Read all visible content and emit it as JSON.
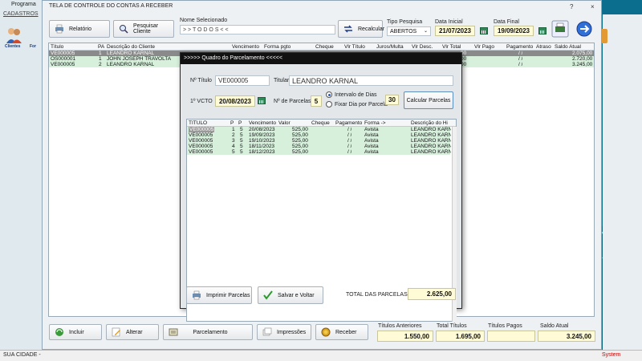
{
  "app": {
    "bg_title": "Programa",
    "bg_menu": "CADASTROS",
    "bg_icons": [
      "Clientes",
      "For"
    ],
    "status_left": "SUA CIDADE -",
    "status_right": "System"
  },
  "window": {
    "title": "TELA DE CONTROLE DO CONTAS A RECEBER",
    "help": "?",
    "close": "×"
  },
  "toolbar": {
    "relatorio": "Relatório",
    "pesquisar_cliente": "Pesquisar Cliente",
    "nome_selecionado_label": "Nome Selecionado",
    "nome_selecionado_value": "> > T O D O S < <",
    "recalcular": "Recalcular",
    "tipo_pesquisa_label": "Tipo  Pesquisa",
    "tipo_pesquisa_value": "ABERTOS",
    "data_inicial_label": "Data Inicial",
    "data_inicial_value": "21/07/2023",
    "data_final_label": "Data Final",
    "data_final_value": "19/09/2023",
    "print_icon_label": "Pesquisar"
  },
  "grid": {
    "columns": [
      "Título",
      "PA",
      "Descrição do Cliente",
      "Vencimento",
      "Forma pgto",
      "Cheque",
      "Vlr Título",
      "Juros/Multa",
      "Vlr Desc.",
      "Vlr Total",
      "Vlr Pago",
      "Pagamento",
      "Atraso",
      "Saldo Atual"
    ],
    "rows": [
      {
        "titulo": "VE000005",
        "pa": "1",
        "cliente": "LEANDRO KARNAL",
        "pagamento": "/ /",
        "saldo": "2.075,00",
        "selected": true
      },
      {
        "titulo": "OS000001",
        "pa": "1",
        "cliente": "JOHN JOSEPH TRAVOLTA",
        "pagamento": "/ /",
        "saldo": "2.720,00",
        "selected": false
      },
      {
        "titulo": "VE000005",
        "pa": "2",
        "cliente": "LEANDRO KARNAL",
        "pagamento": "/ /",
        "saldo": "3.245,00",
        "selected": false
      }
    ],
    "hidden_col_values": [
      "00",
      "00",
      "00"
    ]
  },
  "dialog": {
    "caption": ">>>>>  Quadro do Parcelamento  <<<<<",
    "n_titulo_label": "Nº Título",
    "n_titulo_value": "VE000005",
    "titular_label": "Titular",
    "titular_value": "LEANDRO KARNAL",
    "vcto_label": "1º VCTO",
    "vcto_value": "20/08/2023",
    "n_parcelas_label": "Nº de Parcelas",
    "n_parcelas_value": "5",
    "radio_intervalo": "Intervalo de Dias",
    "radio_fixar": "Fixar Dia por Parcela",
    "intervalo_value": "30",
    "calcular": "Calcular Parcelas",
    "columns": [
      "TITULO",
      "P",
      "P",
      "Vencimento",
      "Valor",
      "Cheque",
      "Pagamento",
      "Forma ->",
      "Descrição do Hi"
    ],
    "rows": [
      {
        "titulo": "VE000005",
        "p1": "1",
        "p2": "5",
        "venc": "20/08/2023",
        "valor": "525,00",
        "pag": "/ /",
        "forma": "Avista",
        "desc": "LEANDRO KARN"
      },
      {
        "titulo": "VE000005",
        "p1": "2",
        "p2": "5",
        "venc": "19/09/2023",
        "valor": "525,00",
        "pag": "/ /",
        "forma": "Avista",
        "desc": "LEANDRO KARN"
      },
      {
        "titulo": "VE000005",
        "p1": "3",
        "p2": "5",
        "venc": "19/10/2023",
        "valor": "525,00",
        "pag": "/ /",
        "forma": "Avista",
        "desc": "LEANDRO KARN"
      },
      {
        "titulo": "VE000005",
        "p1": "4",
        "p2": "5",
        "venc": "18/11/2023",
        "valor": "525,00",
        "pag": "/ /",
        "forma": "Avista",
        "desc": "LEANDRO KARN"
      },
      {
        "titulo": "VE000005",
        "p1": "5",
        "p2": "5",
        "venc": "18/12/2023",
        "valor": "525,00",
        "pag": "/ /",
        "forma": "Avista",
        "desc": "LEANDRO KARN"
      }
    ],
    "imprimir": "Imprimir  Parcelas",
    "salvar": "Salvar e Voltar",
    "total_label": "TOTAL DAS PARCELAS",
    "total_value": "2.625,00"
  },
  "bottom": {
    "incluir": "Incluir",
    "alterar": "Alterar",
    "parcelamento": "Parcelamento",
    "impressoes": "Impressões",
    "receber": "Receber",
    "titulos_anteriores_label": "Títulos Anteriores",
    "titulos_anteriores_value": "1.550,00",
    "total_titulos_label": "Total Títulos",
    "total_titulos_value": "1.695,00",
    "titulos_pagos_label": "Títulos Pagos",
    "titulos_pagos_value": "",
    "saldo_atual_label": "Saldo Atual",
    "saldo_atual_value": "3.245,00"
  }
}
